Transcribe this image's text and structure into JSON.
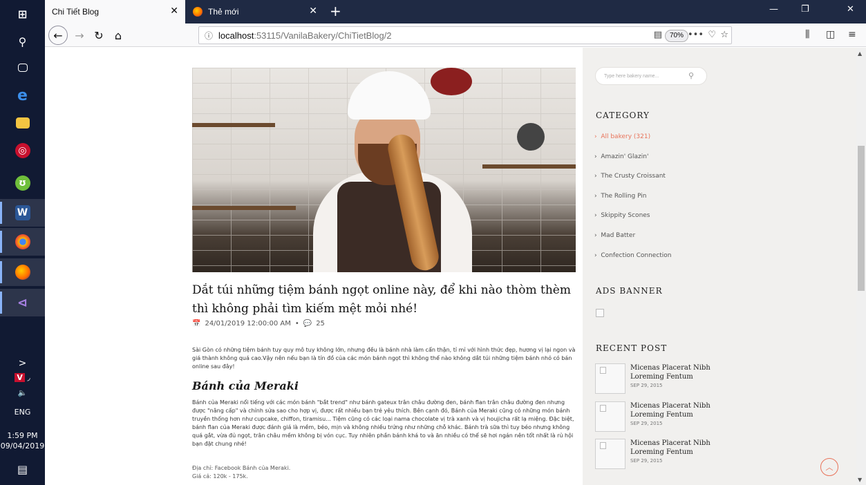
{
  "taskbar": {
    "clock_time": "1:59 PM",
    "clock_date": "09/04/2019",
    "language": "ENG",
    "chevron": ">"
  },
  "browser": {
    "tabs": [
      {
        "label": "Chi Tiết Blog",
        "active": true
      },
      {
        "label": "Thẻ mới",
        "active": false
      }
    ],
    "url_host": "localhost",
    "url_path": ":53115/VanilaBakery/ChiTietBlog/2",
    "zoom": "70%"
  },
  "post": {
    "title": "Dắt túi những tiệm bánh ngọt online này, để khi nào thòm thèm thì không phải tìm kiếm mệt mỏi nhé!",
    "date": "24/01/2019 12:00:00 AM",
    "comments": "25",
    "intro": "Sài Gòn có những tiệm bánh tuy quy mô tuy không lớn, nhưng đều là bánh nhà làm cẩn thận, tỉ mỉ với hình thức đẹp, hương vị lại ngon và giá thành không quá cao.Vậy nên nếu bạn là tín đồ của các món bánh ngọt thì không thể nào không dắt túi những tiệm bánh nhỏ có bán online sau đây!",
    "section_title": "Bánh của Meraki",
    "section_body": "Bánh của Meraki nổi tiếng với các món bánh \"bắt trend\" như bánh gateux trân châu đường đen, bánh flan trân châu đường đen nhưng được \"nâng cấp\" và chỉnh sửa sao cho hợp vị, được rất nhiều bạn trẻ yêu thích. Bên cạnh đó, Bánh của Meraki cũng có những món bánh truyền thống hơn như cupcake, chiffon, tiramisu... Tiệm cũng có các loại nama chocolate vị trà xanh và vị houjicha rất lạ miệng. Đặc biệt, bánh flan của Meraki được đánh giá là mềm, béo, mịn và không nhiều trứng như những chỗ khác. Bánh trà sữa thì tuy béo nhưng không quá gắt, vừa đủ ngọt, trân châu mềm không bị vón cục. Tuy nhiên phần bánh khá to và ăn nhiều có thể sẽ hơi ngán nên tốt nhất là rủ hội bạn đặt chung nhé!",
    "address": "Địa chỉ: Facebook Bánh của Meraki.",
    "price": "Giá cả: 120k - 175k."
  },
  "sidebar": {
    "search_placeholder": "Type here bakery name...",
    "category_heading": "CATEGORY",
    "categories": [
      {
        "label": "All bakery (321)",
        "active": true
      },
      {
        "label": "Amazin' Glazin'",
        "active": false
      },
      {
        "label": "The Crusty Croissant",
        "active": false
      },
      {
        "label": "The Rolling Pin",
        "active": false
      },
      {
        "label": "Skippity Scones",
        "active": false
      },
      {
        "label": "Mad Batter",
        "active": false
      },
      {
        "label": "Confection Connection",
        "active": false
      }
    ],
    "ads_heading": "ADS BANNER",
    "recent_heading": "RECENT POST",
    "recent_posts": [
      {
        "title": "Micenas Placerat Nibh Loreming Fentum",
        "date": "SEP 29, 2015"
      },
      {
        "title": "Micenas Placerat Nibh Loreming Fentum",
        "date": "SEP 29, 2015"
      },
      {
        "title": "Micenas Placerat Nibh Loreming Fentum",
        "date": "SEP 29, 2015"
      }
    ]
  },
  "colors": {
    "accent": "#e8735a",
    "sidebar_bg": "#f1f0ee",
    "taskbar_bg": "#111a33"
  }
}
